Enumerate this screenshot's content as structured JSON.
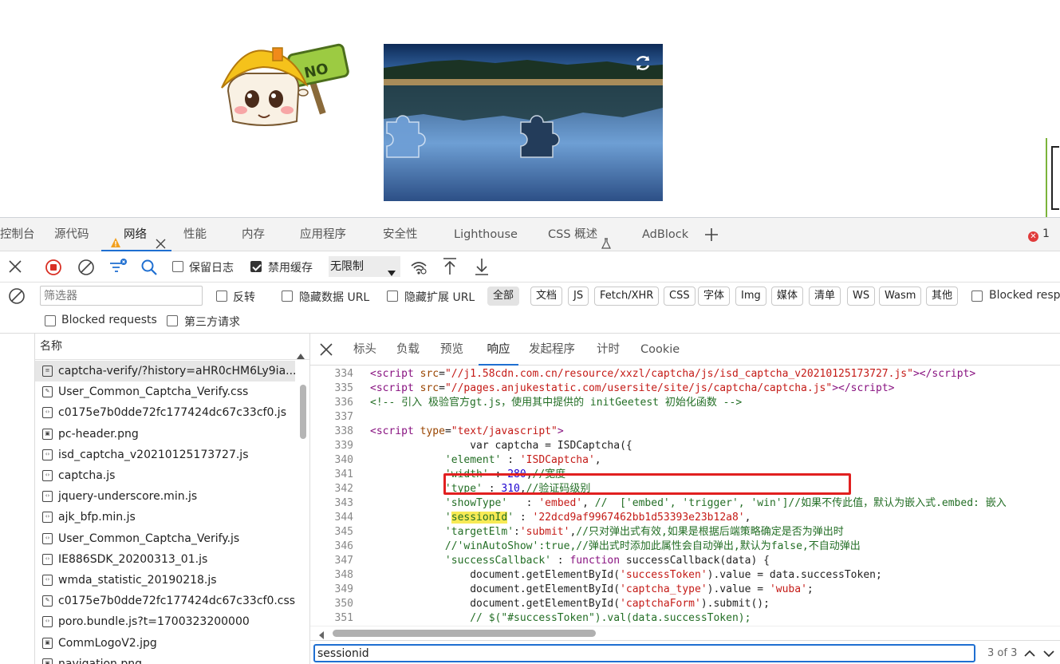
{
  "devtools": {
    "tabs": [
      {
        "label": "控制台"
      },
      {
        "label": "源代码"
      },
      {
        "label": "网络",
        "active": true
      },
      {
        "label": "性能"
      },
      {
        "label": "内存"
      },
      {
        "label": "应用程序"
      },
      {
        "label": "安全性"
      },
      {
        "label": "Lighthouse"
      },
      {
        "label": "CSS 概述"
      },
      {
        "label": "AdBlock"
      }
    ],
    "error_count": "1",
    "toolbar": {
      "preserve_log": "保留日志",
      "disable_cache": "禁用缓存",
      "throttling": "无限制"
    },
    "filter": {
      "placeholder": "筛选器",
      "invert": "反转",
      "hide_data_urls": "隐藏数据 URL",
      "hide_ext_urls": "隐藏扩展 URL",
      "types": [
        "全部",
        "文档",
        "JS",
        "Fetch/XHR",
        "CSS",
        "字体",
        "Img",
        "媒体",
        "清单",
        "WS",
        "Wasm",
        "其他"
      ],
      "blocked_cookies": "Blocked respo",
      "blocked_requests": "Blocked requests",
      "third_party": "第三方请求"
    },
    "request_list": {
      "header": "名称",
      "rows": [
        {
          "icon": "doc",
          "name": "captcha-verify/?history=aHR0cHM6Ly9ia..."
        },
        {
          "icon": "css",
          "name": "User_Common_Captcha_Verify.css"
        },
        {
          "icon": "js",
          "name": "c0175e7b0dde72fc177424dc67c33cf0.js"
        },
        {
          "icon": "img",
          "name": "pc-header.png"
        },
        {
          "icon": "js",
          "name": "isd_captcha_v20210125173727.js"
        },
        {
          "icon": "js",
          "name": "captcha.js"
        },
        {
          "icon": "js",
          "name": "jquery-underscore.min.js"
        },
        {
          "icon": "js",
          "name": "ajk_bfp.min.js"
        },
        {
          "icon": "js",
          "name": "User_Common_Captcha_Verify.js"
        },
        {
          "icon": "js",
          "name": "IE886SDK_20200313_01.js"
        },
        {
          "icon": "js",
          "name": "wmda_statistic_20190218.js"
        },
        {
          "icon": "css",
          "name": "c0175e7b0dde72fc177424dc67c33cf0.css"
        },
        {
          "icon": "js",
          "name": "poro.bundle.js?t=1700323200000"
        },
        {
          "icon": "img",
          "name": "CommLogoV2.jpg"
        },
        {
          "icon": "img",
          "name": "navigation.png"
        }
      ]
    },
    "detail_tabs": [
      {
        "label": "标头"
      },
      {
        "label": "负载"
      },
      {
        "label": "预览"
      },
      {
        "label": "响应",
        "active": true
      },
      {
        "label": "发起程序"
      },
      {
        "label": "计时"
      },
      {
        "label": "Cookie"
      }
    ],
    "code_lines": [
      {
        "n": "334",
        "html": "<span class=\"tag\">&lt;script</span> <span class=\"attr\">src</span>=<span class=\"str\">\"//j1.58cdn.com.cn/resource/xxzl/captcha/js/isd_captcha_v20210125173727.js\"</span><span class=\"tag\">&gt;&lt;/script&gt;</span>"
      },
      {
        "n": "335",
        "html": "<span class=\"tag\">&lt;script</span> <span class=\"attr\">src</span>=<span class=\"str\">\"//pages.anjukestatic.com/usersite/site/js/captcha/captcha.js\"</span><span class=\"tag\">&gt;&lt;/script&gt;</span>"
      },
      {
        "n": "336",
        "html": "<span class=\"cmt\">&lt;!-- 引入 极验官方gt.js，使用其中提供的 initGeetest 初始化函数 --&gt;</span>"
      },
      {
        "n": "337",
        "html": ""
      },
      {
        "n": "338",
        "html": "<span class=\"tag\">&lt;script</span> <span class=\"attr\">type</span>=<span class=\"str\">\"text/javascript\"</span><span class=\"tag\">&gt;</span>"
      },
      {
        "n": "339",
        "html": "                var captcha = ISDCaptcha({"
      },
      {
        "n": "340",
        "html": "            <span class=\"key\">'element'</span> : <span class=\"str\">'ISDCaptcha'</span>,"
      },
      {
        "n": "341",
        "html": "            <span class=\"key\">'width'</span> : <span class=\"num\">280</span>,<span class=\"cmt\">//宽度</span>"
      },
      {
        "n": "342",
        "html": "            <span class=\"key\">'type'</span> : <span class=\"num\">310</span>,<span class=\"cmt\">//验证码级别</span>"
      },
      {
        "n": "343",
        "html": "            <span class=\"key\">'showType'</span>   : <span class=\"str\">'embed'</span>, <span class=\"cmt\">//  ['embed', 'trigger', 'win']//如果不传此值，默认为嵌入式.embed: 嵌入</span>"
      },
      {
        "n": "344",
        "html": "            <span class=\"key\">'<span class=\"hl\">sessionId</span>'</span> : <span class=\"str\">'22dcd9af9967462bb1d53393e23b12a8'</span>,"
      },
      {
        "n": "345",
        "html": "            <span class=\"key\">'targetElm'</span>:<span class=\"str\">'submit'</span>,<span class=\"cmt\">//只对弹出式有效,如果是根据后端策略确定是否为弹出时</span>"
      },
      {
        "n": "346",
        "html": "            <span class=\"cmt\">//'winAutoShow':true,//弹出式时添加此属性会自动弹出,默认为false,不自动弹出</span>"
      },
      {
        "n": "347",
        "html": "            <span class=\"key\">'successCallback'</span> : <span class=\"kw\">function</span> successCallback(data) {"
      },
      {
        "n": "348",
        "html": "                document.getElementById(<span class=\"str\">'successToken'</span>).value = data.successToken;"
      },
      {
        "n": "349",
        "html": "                document.getElementById(<span class=\"str\">'captcha_type'</span>).value = <span class=\"str\">'wuba'</span>;"
      },
      {
        "n": "350",
        "html": "                document.getElementById(<span class=\"str\">'captchaForm'</span>).submit();"
      },
      {
        "n": "351",
        "html": "                <span class=\"cmt\">// $(\"#successToken\").val(data.successToken);</span>"
      }
    ],
    "search": {
      "value": "sessionid",
      "count": "3 of 3"
    }
  },
  "page": {
    "mascot_sign": "NO"
  },
  "colors": {
    "accent": "#1f6fd1",
    "error": "#e03b3b",
    "highlight_box": "#e12020",
    "match_highlight": "#f7ea55"
  }
}
